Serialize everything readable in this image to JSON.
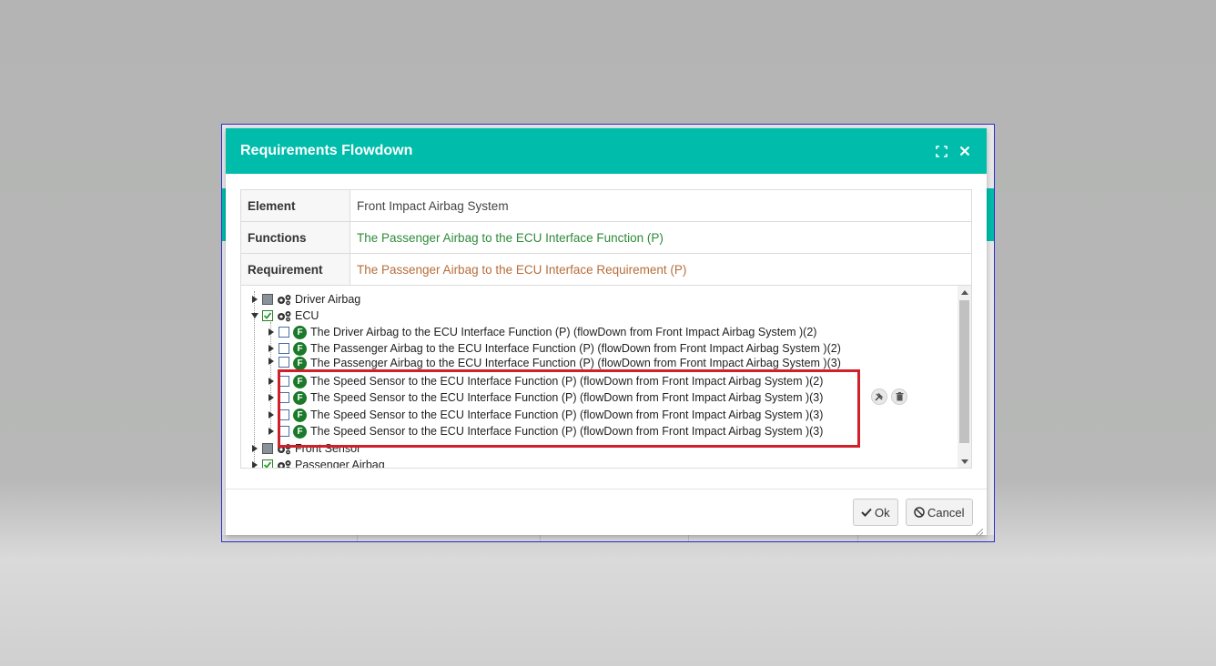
{
  "dialog": {
    "title": "Requirements Flowdown"
  },
  "info": {
    "element_label": "Element",
    "element_value": "Front Impact Airbag System",
    "functions_label": "Functions",
    "functions_value": "The Passenger Airbag to the ECU Interface Function (P)",
    "requirement_label": "Requirement",
    "requirement_value": "The Passenger Airbag to the ECU Interface Requirement (P)"
  },
  "tree": {
    "nodes": [
      {
        "label": "Driver Airbag",
        "state": "partial"
      },
      {
        "label": "ECU",
        "state": "checked"
      },
      {
        "label": "The Driver Airbag to the ECU Interface Function (P) (flowDown from Front Impact Airbag System )(2)",
        "state": "unchecked"
      },
      {
        "label": "The Passenger Airbag to the ECU Interface Function (P) (flowDown from Front Impact Airbag System )(2)",
        "state": "unchecked"
      },
      {
        "label": "The Passenger Airbag to the ECU Interface Function (P) (flowDown from Front Impact Airbag System )(3)",
        "state": "unchecked"
      },
      {
        "label": "The Speed Sensor to the ECU Interface Function (P) (flowDown from Front Impact Airbag System )(2)",
        "state": "unchecked"
      },
      {
        "label": "The Speed Sensor to the ECU Interface Function (P) (flowDown from Front Impact Airbag System )(3)",
        "state": "unchecked"
      },
      {
        "label": "The Speed Sensor to the ECU Interface Function (P) (flowDown from Front Impact Airbag System )(3)",
        "state": "unchecked"
      },
      {
        "label": "The Speed Sensor to the ECU Interface Function (P) (flowDown from Front Impact Airbag System )(3)",
        "state": "unchecked"
      },
      {
        "label": "Front Sensor",
        "state": "partial"
      },
      {
        "label": "Passenger Airbag",
        "state": "checked"
      }
    ],
    "function_badge": "F"
  },
  "buttons": {
    "ok_label": "Ok",
    "cancel_label": "Cancel"
  },
  "colors": {
    "header": "#00bcaa",
    "function_text": "#2e8b3a",
    "requirement_text": "#b86d3a",
    "highlight": "#d0202a"
  }
}
